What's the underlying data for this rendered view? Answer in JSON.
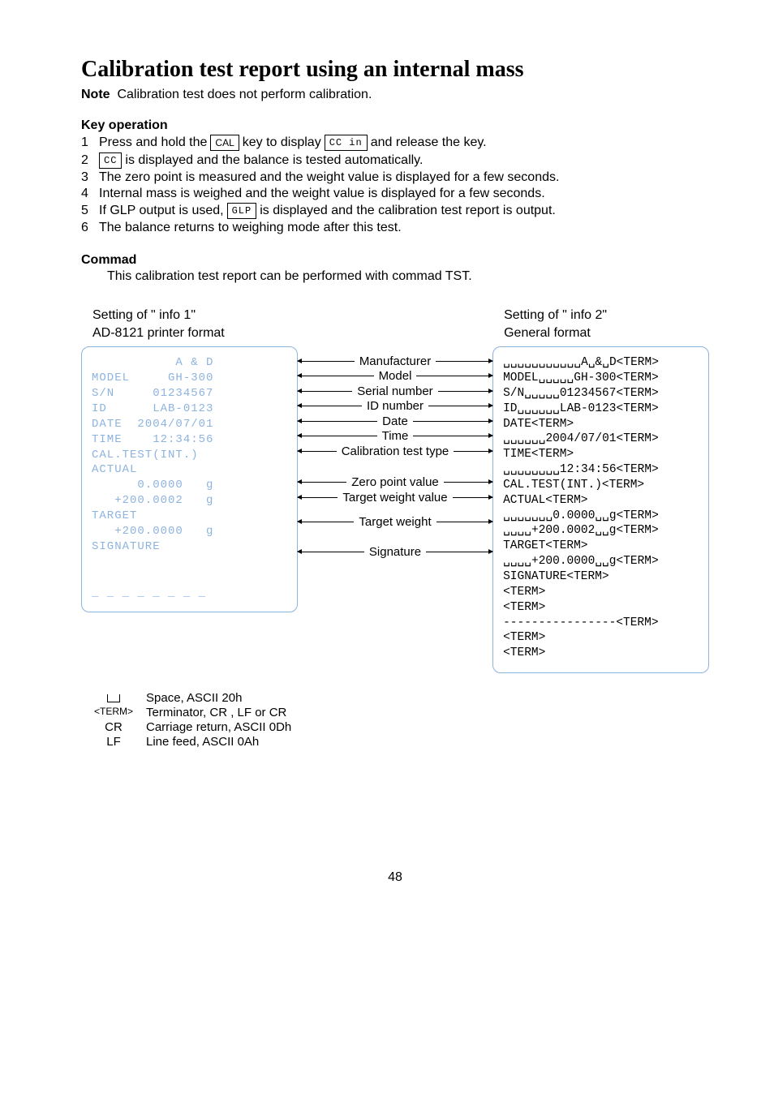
{
  "title": "Calibration test report using an internal mass",
  "note_label": "Note",
  "note_text": "Calibration test does not perform calibration.",
  "keyop_head": "Key operation",
  "keyop": [
    {
      "n": "1",
      "pre": "Press and hold the ",
      "box1": "CAL",
      "mid": " key to display ",
      "box2": "CC in",
      "post": " and release the key."
    },
    {
      "n": "2",
      "box1": "CC",
      "post": " is displayed and the balance is tested automatically."
    },
    {
      "n": "3",
      "post": "The zero point is measured and the weight value is displayed for a few seconds."
    },
    {
      "n": "4",
      "post": "Internal mass is weighed and the weight value is displayed for a few seconds."
    },
    {
      "n": "5",
      "pre": "If GLP output is used, ",
      "box1": "GLP",
      "post": " is displayed and the calibration test report is output."
    },
    {
      "n": "6",
      "post": "The balance returns to weighing mode after this test."
    }
  ],
  "command_head": "Commad",
  "command_text": "This calibration test report can be performed with commad TST.",
  "left_title1": "Setting of \" info 1\"",
  "left_title2": "AD-8121 printer format",
  "right_title1": "Setting of \" info 2\"",
  "right_title2": "General format",
  "left_panel": "           A & D\nMODEL     GH-300\nS/N     01234567\nID      LAB-0123\nDATE  2004/07/01\nTIME    12:34:56\nCAL.TEST(INT.)\nACTUAL\n      0.0000   g\n   +200.0002   g\nTARGET\n   +200.0000   g\nSIGNATURE\n\n\n_ _ _ _ _ _ _ _",
  "right_panel": "␣␣␣␣␣␣␣␣␣␣␣A␣&␣D<TERM>\nMODEL␣␣␣␣␣GH-300<TERM>\nS/N␣␣␣␣␣01234567<TERM>\nID␣␣␣␣␣␣LAB-0123<TERM>\nDATE<TERM>\n␣␣␣␣␣␣2004/07/01<TERM>\nTIME<TERM>\n␣␣␣␣␣␣␣␣12:34:56<TERM>\nCAL.TEST(INT.)<TERM>\nACTUAL<TERM>\n␣␣␣␣␣␣␣0.0000␣␣g<TERM>\n␣␣␣␣+200.0002␣␣g<TERM>\nTARGET<TERM>\n␣␣␣␣+200.0000␣␣g<TERM>\nSIGNATURE<TERM>\n<TERM>\n<TERM>\n----------------<TERM>\n<TERM>\n<TERM>",
  "mid_labels": {
    "mfr": "Manufacturer",
    "model": "Model",
    "sn": "Serial number",
    "id": "ID number",
    "date": "Date",
    "time": "Time",
    "caltype": "Calibration test type",
    "zero": "Zero point value",
    "twv": "Target weight value",
    "tw": "Target weight",
    "sig": "Signature"
  },
  "legend": {
    "space": "Space, ASCII 20h",
    "term": "Terminator, CR , LF or CR",
    "cr": "Carriage return, ASCII 0Dh",
    "lf": "Line feed, ASCII 0Ah"
  },
  "page": "48"
}
